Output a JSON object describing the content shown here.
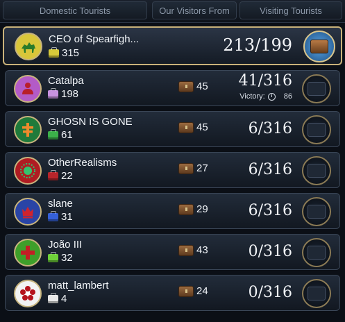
{
  "tabs": {
    "domestic": "Domestic Tourists",
    "visitors_from": "Our Visitors From",
    "visiting": "Visiting Tourists"
  },
  "colors": {
    "selected_border": "#c9b27a",
    "row_border": "#3a4657"
  },
  "rows": [
    {
      "name": "CEO of Spearfigh...",
      "tourism": "315",
      "trade": "",
      "score": "213/199",
      "emblem_bg": "#d9c63a",
      "emblem_fg": "#2a7a2a",
      "icon": "camel-icon",
      "bag_color": "#d6c93a"
    },
    {
      "name": "Catalpa",
      "tourism": "198",
      "trade": "45",
      "score": "41/316",
      "victory_label": "Victory:",
      "victory_turns": "86",
      "emblem_bg": "#b35bc7",
      "emblem_fg": "#b81f2a",
      "icon": "figure-icon",
      "bag_color": "#c892e0"
    },
    {
      "name": "GHOSN IS GONE",
      "tourism": "61",
      "trade": "45",
      "score": "6/316",
      "emblem_bg": "#1f7a3a",
      "emblem_fg": "#f08a2c",
      "icon": "cross-icon",
      "bag_color": "#3cb04a"
    },
    {
      "name": "OtherRealisms",
      "tourism": "22",
      "trade": "27",
      "score": "6/316",
      "emblem_bg": "#b01c22",
      "emblem_fg": "#34c26d",
      "icon": "sun-icon",
      "bag_color": "#b8252b"
    },
    {
      "name": "slane",
      "tourism": "31",
      "trade": "29",
      "score": "6/316",
      "emblem_bg": "#2944a6",
      "emblem_fg": "#d0232d",
      "icon": "crown-icon",
      "bag_color": "#3560d8"
    },
    {
      "name": "João III",
      "tourism": "32",
      "trade": "43",
      "score": "0/316",
      "emblem_bg": "#3e9f2a",
      "emblem_fg": "#c41e25",
      "icon": "quad-cross-icon",
      "bag_color": "#6fd03a"
    },
    {
      "name": "matt_lambert",
      "tourism": "4",
      "trade": "24",
      "score": "0/316",
      "emblem_bg": "#f2f2f2",
      "emblem_fg": "#b5121b",
      "icon": "flower-icon",
      "bag_color": "#e8e8e8"
    }
  ]
}
